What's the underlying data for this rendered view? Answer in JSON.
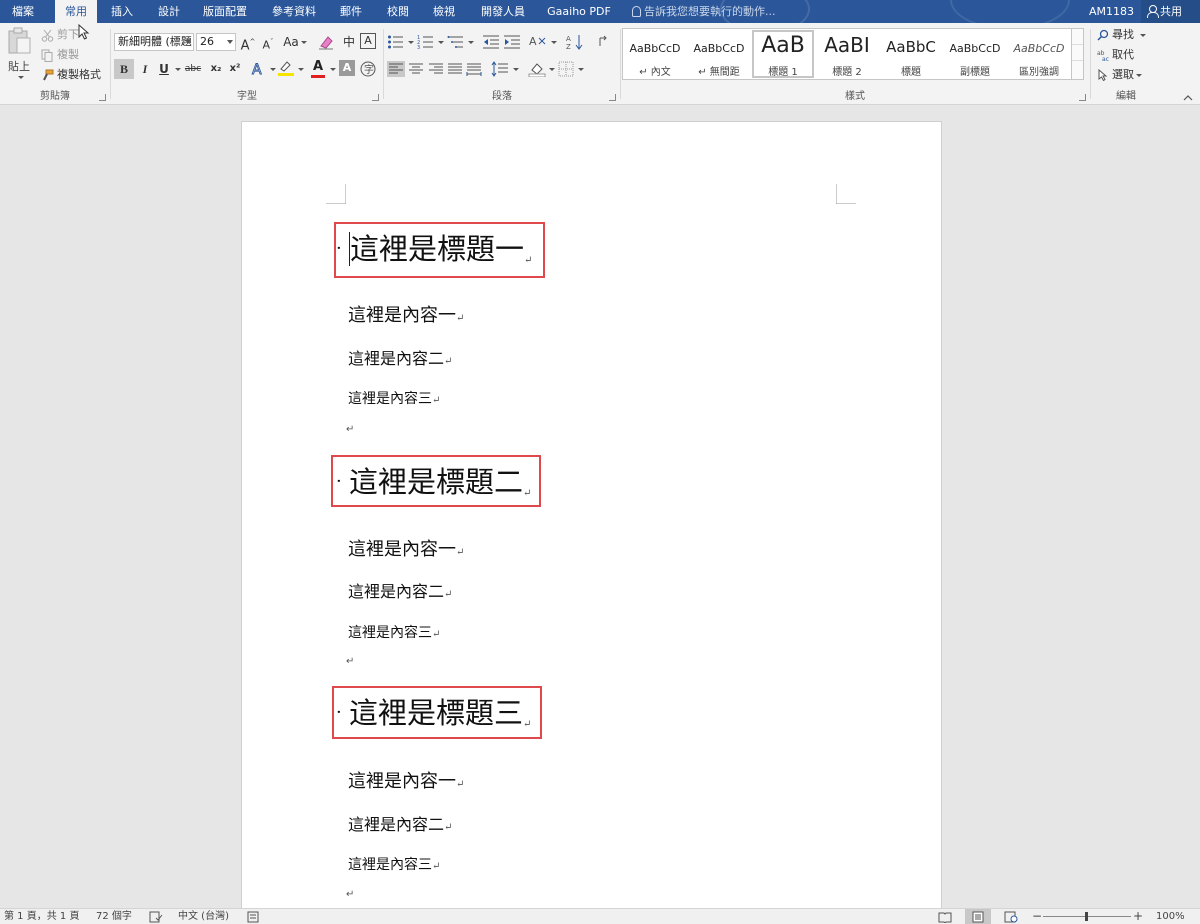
{
  "tabs": [
    {
      "label": "檔案",
      "active": false
    },
    {
      "label": "常用",
      "active": true
    },
    {
      "label": "插入",
      "active": false
    },
    {
      "label": "設計",
      "active": false
    },
    {
      "label": "版面配置",
      "active": false
    },
    {
      "label": "參考資料",
      "active": false
    },
    {
      "label": "郵件",
      "active": false
    },
    {
      "label": "校閱",
      "active": false
    },
    {
      "label": "檢視",
      "active": false
    },
    {
      "label": "開發人員",
      "active": false
    },
    {
      "label": "Gaaiho PDF",
      "active": false
    }
  ],
  "tell_me": "告訴我您想要執行的動作...",
  "account": "AM1183",
  "share": "共用",
  "clipboard": {
    "paste": "貼上",
    "cut": "剪下",
    "copy": "複製",
    "format_painter": "複製格式",
    "group_label": "剪貼簿"
  },
  "font": {
    "name": "新細明體 (標題",
    "size": "26",
    "case_label": "Aa",
    "phonetic_label": "中",
    "bold": "B",
    "italic": "I",
    "underline": "U",
    "strike": "abc",
    "subscript": "x₂",
    "superscript": "x²",
    "font_color_letter": "A",
    "shade_letter": "A",
    "group_label": "字型"
  },
  "paragraph": {
    "group_label": "段落"
  },
  "styles": {
    "items": [
      {
        "sample": "AaBbCcD",
        "name": "↵ 內文"
      },
      {
        "sample": "AaBbCcD",
        "name": "↵ 無間距"
      },
      {
        "sample": "AaB",
        "name": "標題 1"
      },
      {
        "sample": "AaBI",
        "name": "標題 2"
      },
      {
        "sample": "AaBbC",
        "name": "標題"
      },
      {
        "sample": "AaBbCcD",
        "name": "副標題"
      },
      {
        "sample": "AaBbCcD",
        "name": "區別強調"
      }
    ],
    "selected": "標題 1",
    "group_label": "樣式"
  },
  "editing": {
    "find": "尋找",
    "replace": "取代",
    "select": "選取",
    "group_label": "編輯"
  },
  "document": {
    "sections": [
      {
        "heading": "這裡是標題一",
        "lines": [
          "這裡是內容一",
          "這裡是內容二",
          "這裡是內容三"
        ]
      },
      {
        "heading": "這裡是標題二",
        "lines": [
          "這裡是內容一",
          "這裡是內容二",
          "這裡是內容三"
        ]
      },
      {
        "heading": "這裡是標題三",
        "lines": [
          "這裡是內容一",
          "這裡是內容二",
          "這裡是內容三"
        ]
      }
    ],
    "para_mark": "↵"
  },
  "status": {
    "page": "第 1 頁，共 1 頁",
    "words": "72 個字",
    "language": "中文 (台灣)",
    "zoom": "100%",
    "zoom_minus": "−",
    "zoom_plus": "+"
  },
  "colors": {
    "title_bar": "#2b579a",
    "highlight_box": "#e0494b",
    "font_color": "#e0201f",
    "shade_color": "#f5e400"
  }
}
